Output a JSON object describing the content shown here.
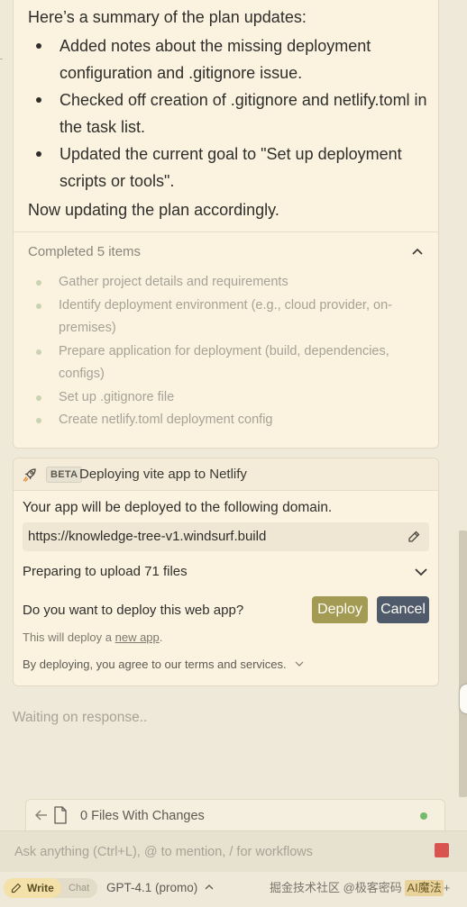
{
  "summary": {
    "intro": "Here’s a summary of the plan updates:",
    "bullets": [
      "Added notes about the missing deployment configuration and .gitignore issue.",
      "Checked off creation of .gitignore and netlify.toml in the task list.",
      "Updated the current goal to \"Set up deployment scripts or tools\"."
    ],
    "outro": "Now updating the plan accordingly."
  },
  "completed": {
    "title": "Completed 5 items",
    "items": [
      "Gather project details and requirements",
      "Identify deployment environment (e.g., cloud provider, on-premises)",
      "Prepare application for deployment (build, dependencies, configs)",
      "Set up .gitignore file",
      "Create netlify.toml deployment config"
    ]
  },
  "deploy": {
    "badge": "BETA",
    "title": "Deploying vite app to Netlify",
    "description": "Your app will be deployed to the following domain.",
    "domain": "https://knowledge-tree-v1.windsurf.build",
    "upload_status": "Preparing to upload 71 files",
    "question": "Do you want to deploy this web app?",
    "deploy_label": "Deploy",
    "cancel_label": "Cancel",
    "note_prefix": "This will deploy a ",
    "note_link": "new app",
    "note_suffix": ".",
    "terms": "By deploying, you agree to our terms and services."
  },
  "waiting_text": "Waiting on response..",
  "files": {
    "label": "0 Files With Changes"
  },
  "input": {
    "placeholder": "Ask anything (Ctrl+L), @ to mention, / for workflows"
  },
  "toolbar": {
    "write_label": "Write",
    "chat_label": "Chat",
    "model": "GPT-4.1 (promo)"
  },
  "watermark": {
    "text": "掘金技术社区 @极客密码 ",
    "badge": "AI魔法"
  },
  "colors": {
    "deploy_button": "#a39a54",
    "cancel_button": "#4f5a6a",
    "status_dot": "#76b96a",
    "stop_button": "#d9534f"
  }
}
